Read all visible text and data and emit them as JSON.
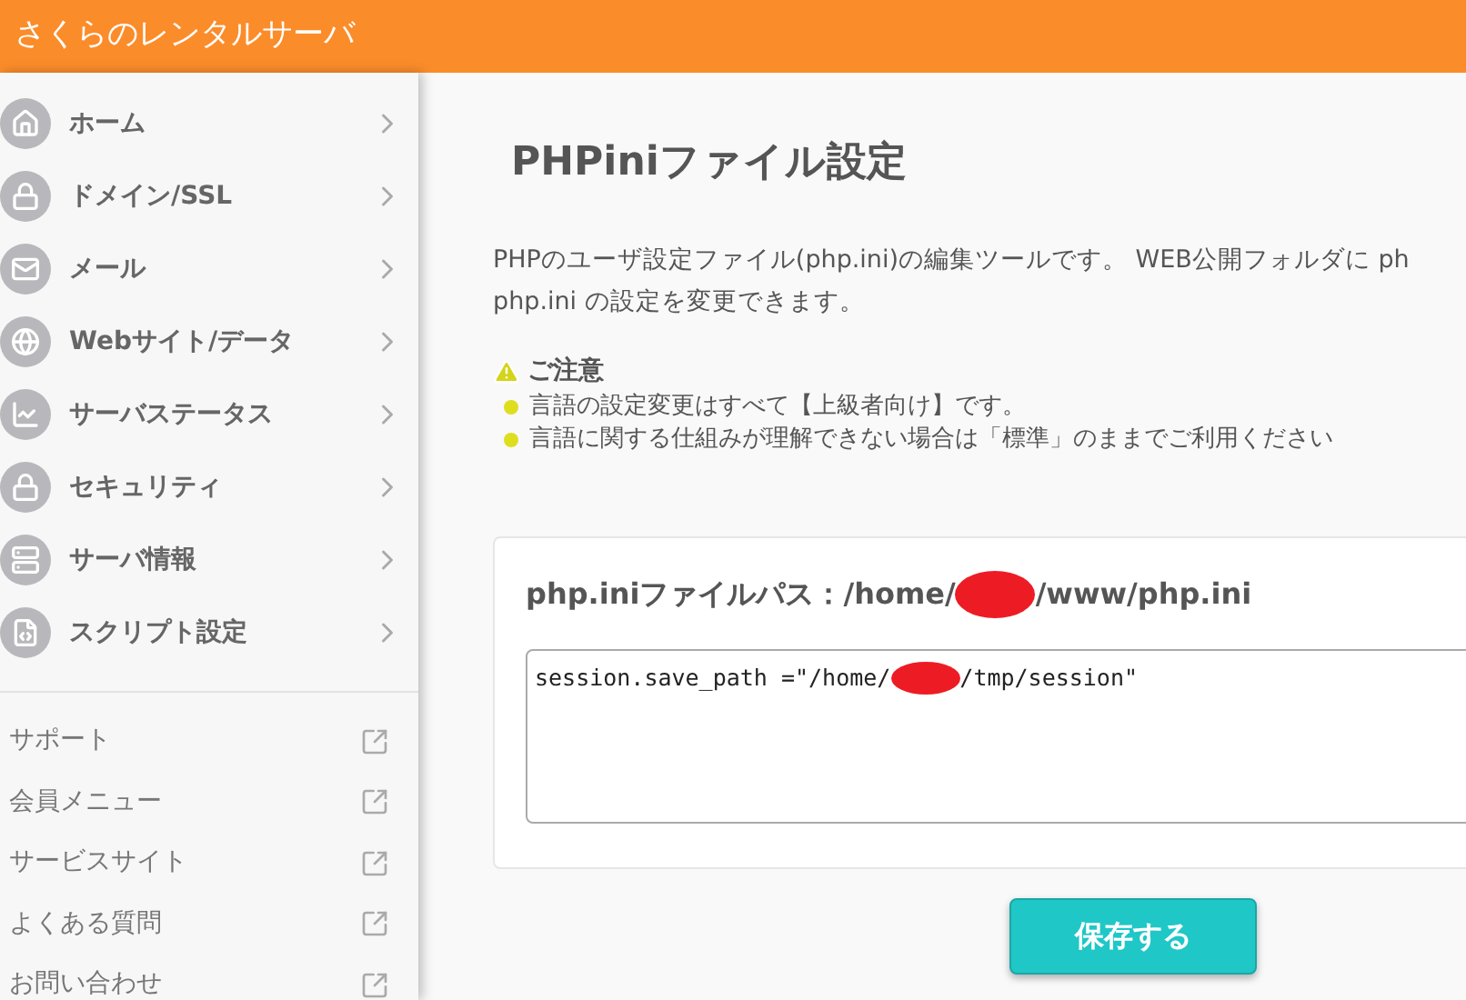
{
  "header": {
    "title": "さくらのレンタルサーバ"
  },
  "sidebar": {
    "items": [
      {
        "label": "ホーム"
      },
      {
        "label": "ドメイン/SSL"
      },
      {
        "label": "メール"
      },
      {
        "label": "Webサイト/データ"
      },
      {
        "label": "サーバステータス"
      },
      {
        "label": "セキュリティ"
      },
      {
        "label": "サーバ情報"
      },
      {
        "label": "スクリプト設定"
      }
    ],
    "links": [
      "サポート",
      "会員メニュー",
      "サービスサイト",
      "よくある質問",
      "お問い合わせ"
    ]
  },
  "page": {
    "title": "PHPiniファイル設定",
    "description": [
      "PHPのユーザ設定ファイル(php.ini)の編集ツールです。 WEB公開フォルダに ph",
      "php.ini の設定を変更できます。"
    ],
    "notice": {
      "title": "ご注意",
      "items": [
        "言語の設定変更はすべて【上級者向け】です。",
        "言語に関する仕組みが理解できない場合は「標準」のままでご利用ください"
      ]
    },
    "file_path": {
      "label": "php.iniファイルパス：/home/",
      "suffix": "/www/php.ini"
    },
    "editor": {
      "before": "session.save_path =\"/home/",
      "after": "/tmp/session\""
    },
    "save_button": "保存する"
  }
}
